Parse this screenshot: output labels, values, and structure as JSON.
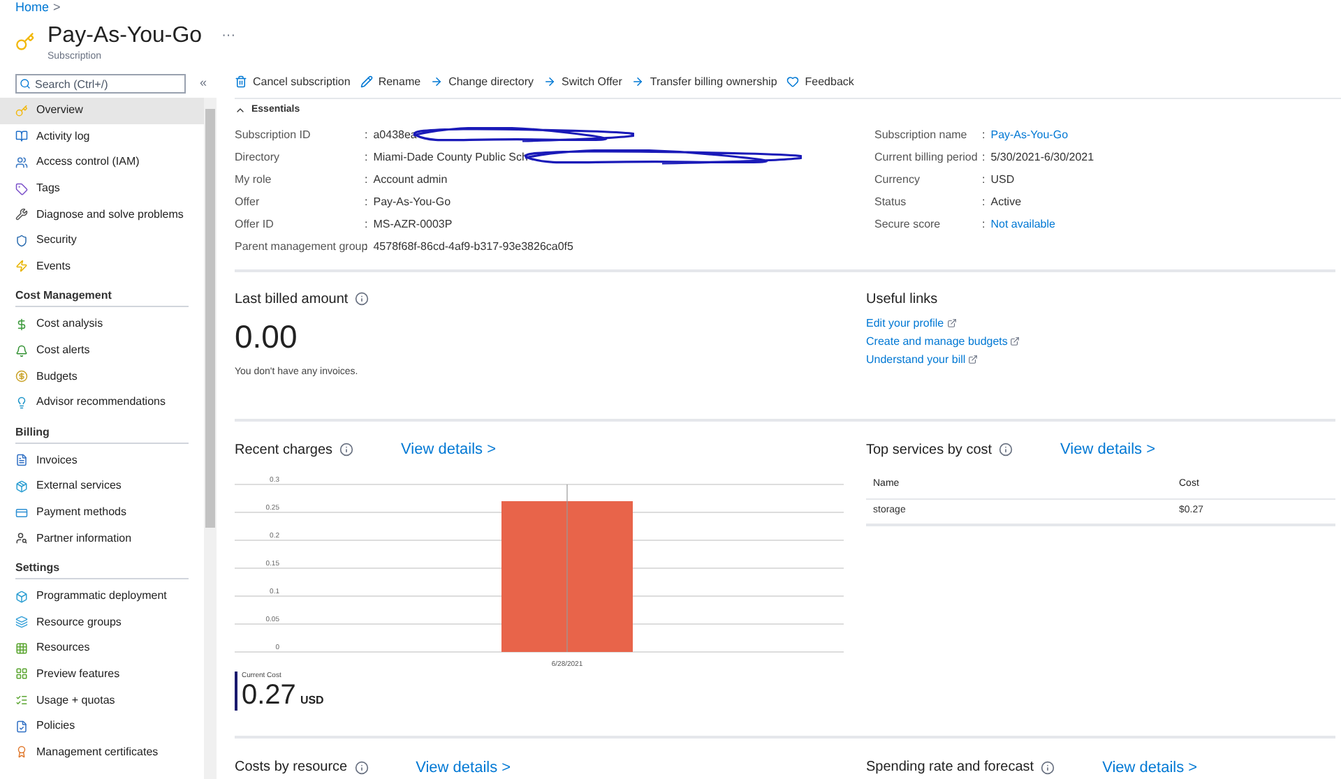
{
  "breadcrumb": {
    "items": [
      "Home"
    ],
    "separator": ">"
  },
  "header": {
    "title": "Pay-As-You-Go",
    "subtitle": "Subscription",
    "more": "···"
  },
  "sidebar": {
    "search": {
      "placeholder": "Search (Ctrl+/)"
    },
    "collapse": "«",
    "sections": [
      {
        "items": [
          {
            "label": "Overview",
            "selected": true
          },
          {
            "label": "Activity log",
            "selected": false
          },
          {
            "label": "Access control (IAM)",
            "selected": false
          },
          {
            "label": "Tags",
            "selected": false
          },
          {
            "label": "Diagnose and solve problems",
            "selected": false
          },
          {
            "label": "Security",
            "selected": false
          },
          {
            "label": "Events",
            "selected": false
          }
        ]
      },
      {
        "heading": "Cost Management",
        "items": [
          {
            "label": "Cost analysis",
            "selected": false
          },
          {
            "label": "Cost alerts",
            "selected": false
          },
          {
            "label": "Budgets",
            "selected": false
          },
          {
            "label": "Advisor recommendations",
            "selected": false
          }
        ]
      },
      {
        "heading": "Billing",
        "items": [
          {
            "label": "Invoices",
            "selected": false
          },
          {
            "label": "External services",
            "selected": false
          },
          {
            "label": "Payment methods",
            "selected": false
          },
          {
            "label": "Partner information",
            "selected": false
          }
        ]
      },
      {
        "heading": "Settings",
        "items": [
          {
            "label": "Programmatic deployment",
            "selected": false
          },
          {
            "label": "Resource groups",
            "selected": false
          },
          {
            "label": "Resources",
            "selected": false
          },
          {
            "label": "Preview features",
            "selected": false
          },
          {
            "label": "Usage + quotas",
            "selected": false
          },
          {
            "label": "Policies",
            "selected": false
          },
          {
            "label": "Management certificates",
            "selected": false
          }
        ]
      }
    ]
  },
  "toolbar": [
    "Cancel subscription",
    "Rename",
    "Change directory",
    "Switch Offer",
    "Transfer billing ownership",
    "Feedback"
  ],
  "essentials": {
    "title": "Essentials",
    "expanded": true,
    "separator": ":",
    "left": [
      {
        "label": "Subscription ID",
        "value": "a0438ea",
        "kind": "redacted"
      },
      {
        "label": "Directory",
        "value": "Miami-Dade County Public Sch",
        "kind": "redacted"
      },
      {
        "label": "My role",
        "value": "Account admin",
        "kind": "text"
      },
      {
        "label": "Offer",
        "value": "Pay-As-You-Go",
        "kind": "text"
      },
      {
        "label": "Offer ID",
        "value": "MS-AZR-0003P",
        "kind": "text"
      },
      {
        "label": "Parent management group",
        "value": "4578f68f-86cd-4af9-b317-93e3826ca0f5",
        "kind": "text"
      }
    ],
    "right": [
      {
        "label": "Subscription name",
        "value": "Pay-As-You-Go",
        "kind": "link"
      },
      {
        "label": "Current billing period",
        "value": "5/30/2021-6/30/2021",
        "kind": "text"
      },
      {
        "label": "Currency",
        "value": "USD",
        "kind": "text"
      },
      {
        "label": "Status",
        "value": "Active",
        "kind": "text"
      },
      {
        "label": "Secure score",
        "value": "Not available",
        "kind": "link"
      }
    ]
  },
  "last_billed": {
    "title": "Last billed amount",
    "amount": "0.00",
    "note": "You don't have any invoices."
  },
  "useful_links": {
    "title": "Useful links",
    "links": [
      "Edit your profile",
      "Create and manage budgets",
      "Understand your bill"
    ]
  },
  "recent_charges": {
    "title": "Recent charges",
    "view_details": "View details >",
    "chart_data": {
      "type": "bar",
      "grid": true,
      "categories": [
        "6/28/2021"
      ],
      "series": [
        {
          "color": "#e8644a",
          "values": [
            0.27
          ]
        }
      ],
      "ref_lines": [
        {
          "axis": "x",
          "value": "6/28/2021",
          "color": "#999999"
        }
      ],
      "ylim": [
        0,
        0.3
      ],
      "yticks": [
        0,
        {
          "value": 0.05,
          "label": "0.05"
        },
        {
          "value": 0.1,
          "label": "0.1"
        },
        {
          "value": 0.15,
          "label": "0.15"
        },
        {
          "value": 0.2,
          "label": "0.2"
        },
        {
          "value": 0.25,
          "label": "0.25"
        },
        {
          "value": 0.3,
          "label": "0.3"
        }
      ]
    },
    "current_cost": {
      "label": "Current Cost",
      "amount": "0.27",
      "currency": "USD"
    }
  },
  "top_services": {
    "title": "Top services by cost",
    "view_details": "View details >",
    "columns": [
      "Name",
      "Cost"
    ],
    "rows": [
      [
        "storage",
        "$0.27"
      ]
    ]
  },
  "costs_by_resource": {
    "title": "Costs by resource",
    "view_details": "View details >"
  },
  "spending_rate": {
    "title": "Spending rate and forecast",
    "view_details": "View details >"
  }
}
